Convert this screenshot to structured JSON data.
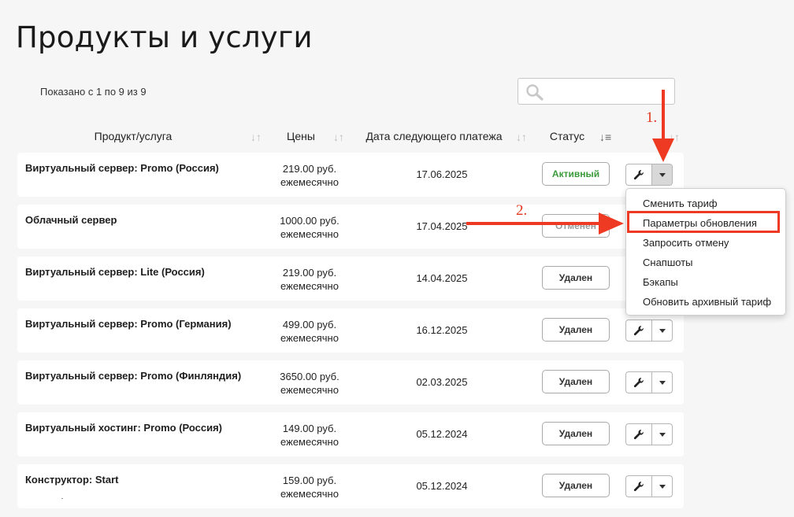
{
  "page": {
    "title": "Продукты и услуги",
    "shown_info": "Показано с 1 по 9 из 9",
    "search": {
      "placeholder": "",
      "value": ""
    }
  },
  "table": {
    "columns": [
      "Продукт/услуга",
      "Цены",
      "Дата следующего платежа",
      "Статус"
    ],
    "rows": [
      {
        "product": "Виртуальный сервер: Promo (Россия)",
        "price": "219.00 руб.",
        "period": "ежемесячно",
        "date": "17.06.2025",
        "status": "Активный",
        "status_kind": "active"
      },
      {
        "product": "Облачный сервер",
        "price": "1000.00 руб.",
        "period": "ежемесячно",
        "date": "17.04.2025",
        "status": "Отменен",
        "status_kind": "cancelled"
      },
      {
        "product": "Виртуальный сервер: Lite (Россия)",
        "price": "219.00 руб.",
        "period": "ежемесячно",
        "date": "14.04.2025",
        "status": "Удален",
        "status_kind": "deleted"
      },
      {
        "product": "Виртуальный сервер: Promo (Германия)",
        "price": "499.00 руб.",
        "period": "ежемесячно",
        "date": "16.12.2025",
        "status": "Удален",
        "status_kind": "deleted"
      },
      {
        "product": "Виртуальный сервер: Promo (Финляндия)",
        "price": "3650.00 руб.",
        "period": "ежемесячно",
        "date": "02.03.2025",
        "status": "Удален",
        "status_kind": "deleted"
      },
      {
        "product": "Виртуальный хостинг: Promo (Россия)",
        "price": "149.00 руб.",
        "period": "ежемесячно",
        "date": "05.12.2024",
        "status": "Удален",
        "status_kind": "deleted"
      },
      {
        "product": "Конструктор: Start",
        "price": "159.00 руб.",
        "period": "ежемесячно",
        "date": "05.12.2024",
        "status": "Удален",
        "status_kind": "deleted"
      }
    ]
  },
  "dropdown": {
    "items": [
      "Сменить тариф",
      "Параметры обновления",
      "Запросить отмену",
      "Снапшоты",
      "Бэкапы",
      "Обновить архивный тариф"
    ],
    "highlighted": "Параметры обновления"
  },
  "annotations": {
    "step1": "1.",
    "step2": "2."
  },
  "icons": {
    "search": "search-icon",
    "sort": "sort-icon",
    "wrench": "wrench-icon",
    "caret": "caret-down-icon"
  },
  "colors": {
    "accent_red": "#e5331c",
    "status_active": "#3a9b3a",
    "status_cancelled": "#9a9a9a",
    "background": "#f6f6f6"
  }
}
